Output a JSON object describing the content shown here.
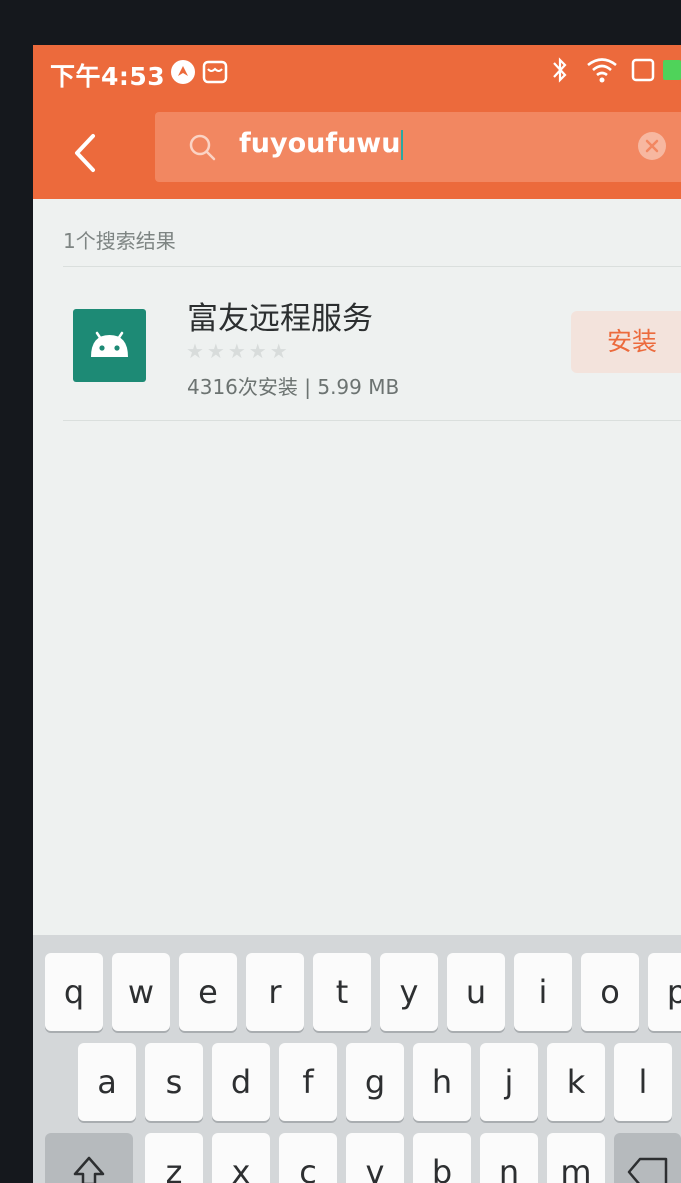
{
  "status_bar": {
    "time": "下午4:53",
    "icons": [
      "navigation-badge-icon",
      "store-icon",
      "bluetooth-icon",
      "wifi-icon",
      "battery-icon"
    ]
  },
  "app_bar": {
    "search_query": "fuyoufuwu",
    "back_icon": "chevron-left-icon",
    "search_icon": "search-icon",
    "clear_icon": "clear-icon"
  },
  "results": {
    "count_label": "1个搜索结果",
    "items": [
      {
        "name": "富友远程服务",
        "rating_stars": 0,
        "meta": "4316次安装 | 5.99 MB",
        "install_label": "安装",
        "icon": "android-icon"
      }
    ]
  },
  "keyboard": {
    "row1": [
      "q",
      "w",
      "e",
      "r",
      "t",
      "y",
      "u",
      "i",
      "o",
      "p"
    ],
    "row2": [
      "a",
      "s",
      "d",
      "f",
      "g",
      "h",
      "j",
      "k",
      "l"
    ],
    "row3": [
      "z",
      "x",
      "c",
      "v",
      "b",
      "n",
      "m"
    ],
    "shift_icon": "shift-icon",
    "backspace_icon": "backspace-icon"
  },
  "colors": {
    "accent": "#ec6a3c",
    "app_icon": "#1d8a75",
    "background": "#eef1f0"
  }
}
